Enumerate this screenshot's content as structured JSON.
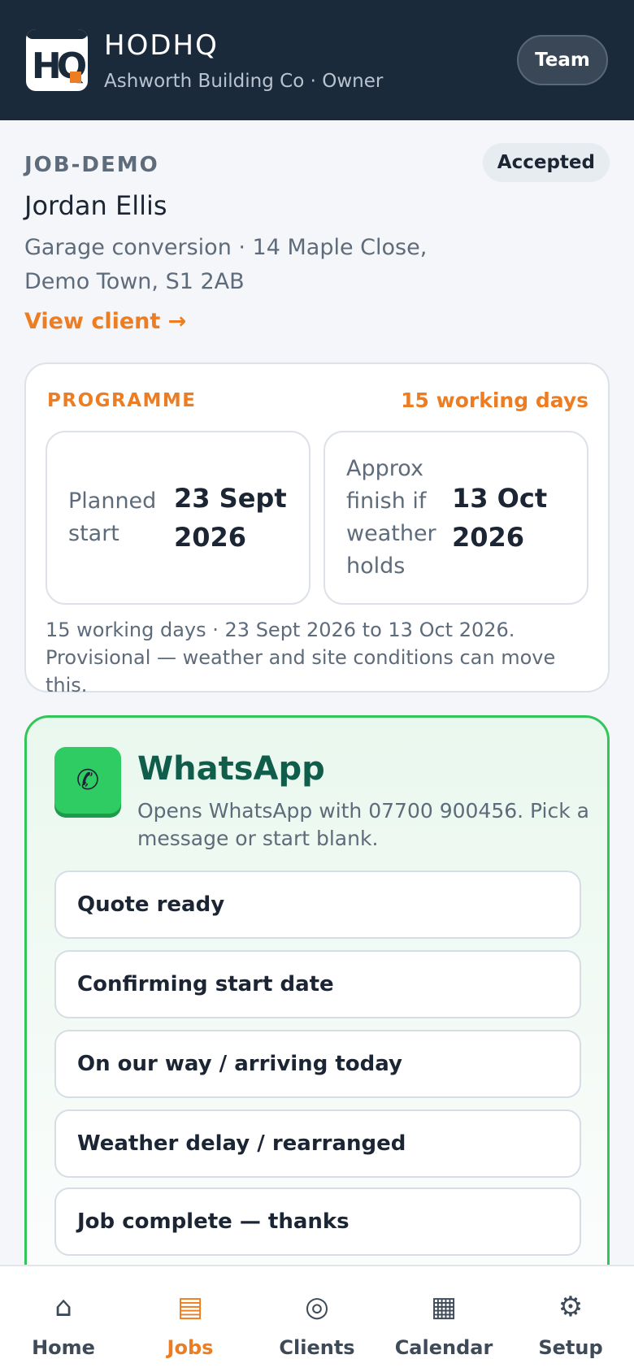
{
  "header": {
    "logo_text": "HQ",
    "app_name": "HODHQ",
    "subtitle": "Ashworth Building Co · Owner",
    "team_button": "Team"
  },
  "job": {
    "reference": "JOB-DEMO",
    "status": "Accepted",
    "client_name": "Jordan Ellis",
    "description": "Garage conversion · 14 Maple Close, Demo Town, S1 2AB",
    "view_client": "View client →"
  },
  "programme": {
    "label": "PROGRAMME",
    "duration": "15 working days",
    "planned_start_label": "Planned start",
    "planned_start_value": "23 Sept 2026",
    "finish_label": "Approx finish if weather holds",
    "finish_value": "13 Oct 2026",
    "note": "15 working days · 23 Sept 2026 to 13 Oct 2026. Provisional — weather and site conditions can move this."
  },
  "whatsapp": {
    "icon": "phone-icon",
    "title": "WhatsApp",
    "description": "Opens WhatsApp with 07700 900456. Pick a message or start blank.",
    "messages": [
      "Quote ready",
      "Confirming start date",
      "On our way / arriving today",
      "Weather delay / rearranged",
      "Job complete — thanks"
    ]
  },
  "nav": {
    "items": [
      {
        "label": "Home",
        "icon": "home-icon"
      },
      {
        "label": "Jobs",
        "icon": "jobs-icon"
      },
      {
        "label": "Clients",
        "icon": "clients-icon"
      },
      {
        "label": "Calendar",
        "icon": "calendar-icon"
      },
      {
        "label": "Setup",
        "icon": "gear-icon"
      }
    ],
    "active": "Jobs"
  },
  "colors": {
    "header_bg": "#1b2a3a",
    "accent": "#ec7d23",
    "whatsapp_green": "#2ecc63",
    "whatsapp_title": "#0f5d4a"
  }
}
